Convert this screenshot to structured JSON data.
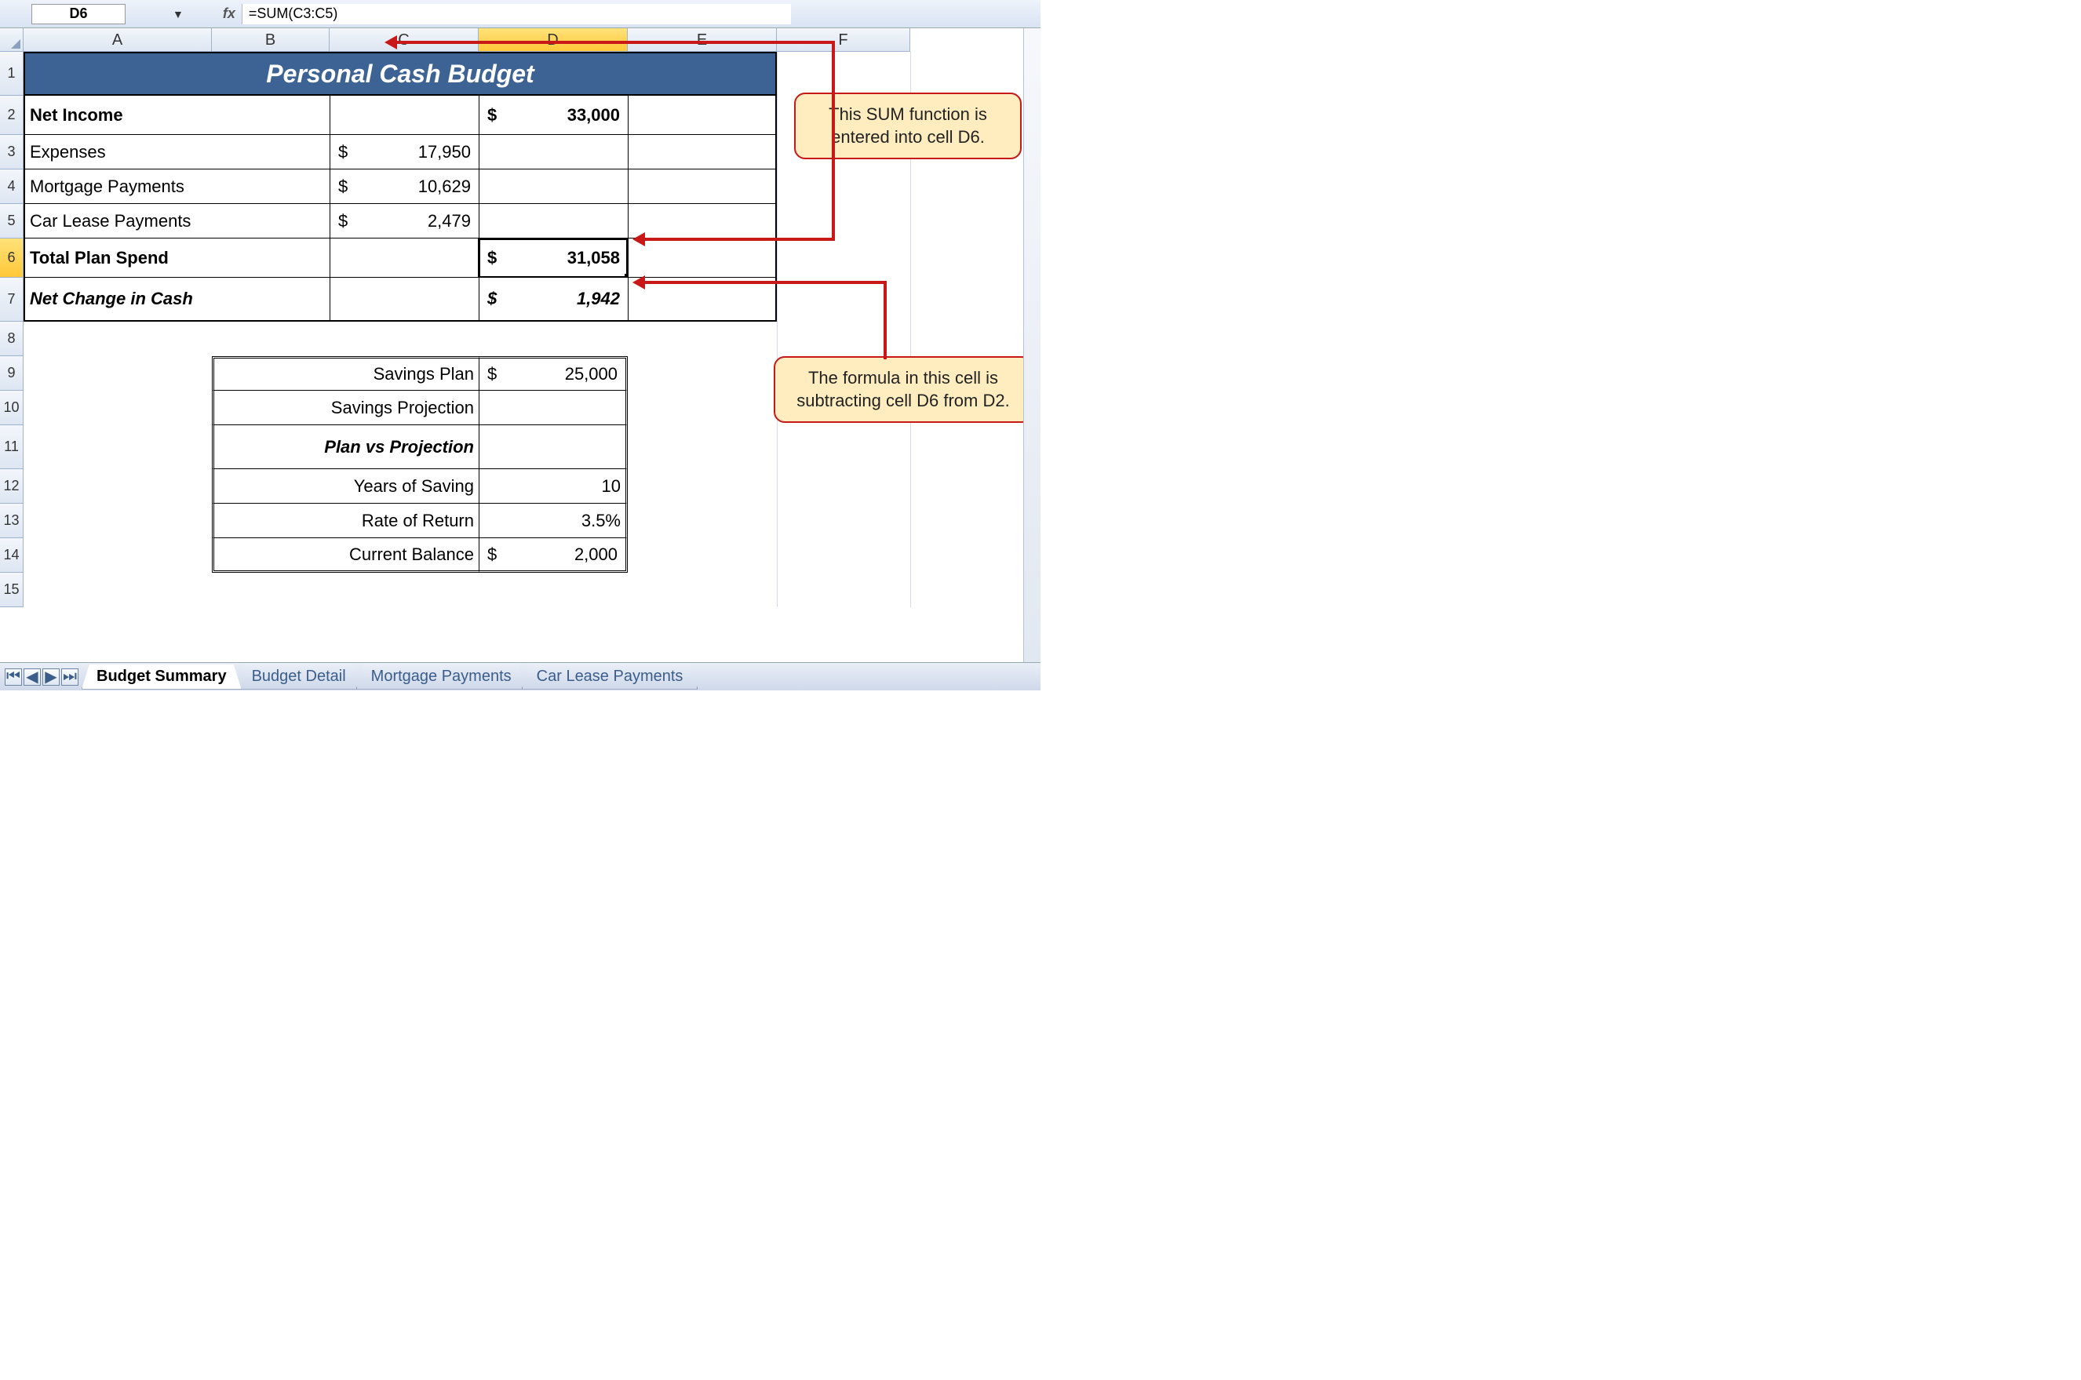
{
  "namebox": "D6",
  "fx_label": "fx",
  "formula": "=SUM(C3:C5)",
  "columns": [
    "A",
    "B",
    "C",
    "D",
    "E",
    "F"
  ],
  "rows": [
    "1",
    "2",
    "3",
    "4",
    "5",
    "6",
    "7",
    "8",
    "9",
    "10",
    "11",
    "12",
    "13",
    "14",
    "15"
  ],
  "title": "Personal Cash Budget",
  "r2": {
    "label": "Net Income",
    "amount": "33,000",
    "cur": "$"
  },
  "r3": {
    "label": "Expenses",
    "amount": "17,950",
    "cur": "$"
  },
  "r4": {
    "label": "Mortgage Payments",
    "amount": "10,629",
    "cur": "$"
  },
  "r5": {
    "label": "Car Lease Payments",
    "amount": "2,479",
    "cur": "$"
  },
  "r6": {
    "label": "Total Plan Spend",
    "amount": "31,058",
    "cur": "$"
  },
  "r7": {
    "label": "Net Change in Cash",
    "amount": "1,942",
    "cur": "$"
  },
  "r9": {
    "label": "Savings Plan",
    "amount": "25,000",
    "cur": "$"
  },
  "r10": {
    "label": "Savings Projection"
  },
  "r11": {
    "label": "Plan vs Projection"
  },
  "r12": {
    "label": "Years of Saving",
    "value": "10"
  },
  "r13": {
    "label": "Rate of Return",
    "value": "3.5%"
  },
  "r14": {
    "label": "Current Balance",
    "amount": "2,000",
    "cur": "$"
  },
  "callout1": "This SUM function is entered into cell D6.",
  "callout2": "The formula in this cell is subtracting cell D6 from D2.",
  "tabs": {
    "active": "Budget Summary",
    "t2": "Budget Detail",
    "t3": "Mortgage Payments",
    "t4": "Car Lease Payments"
  }
}
